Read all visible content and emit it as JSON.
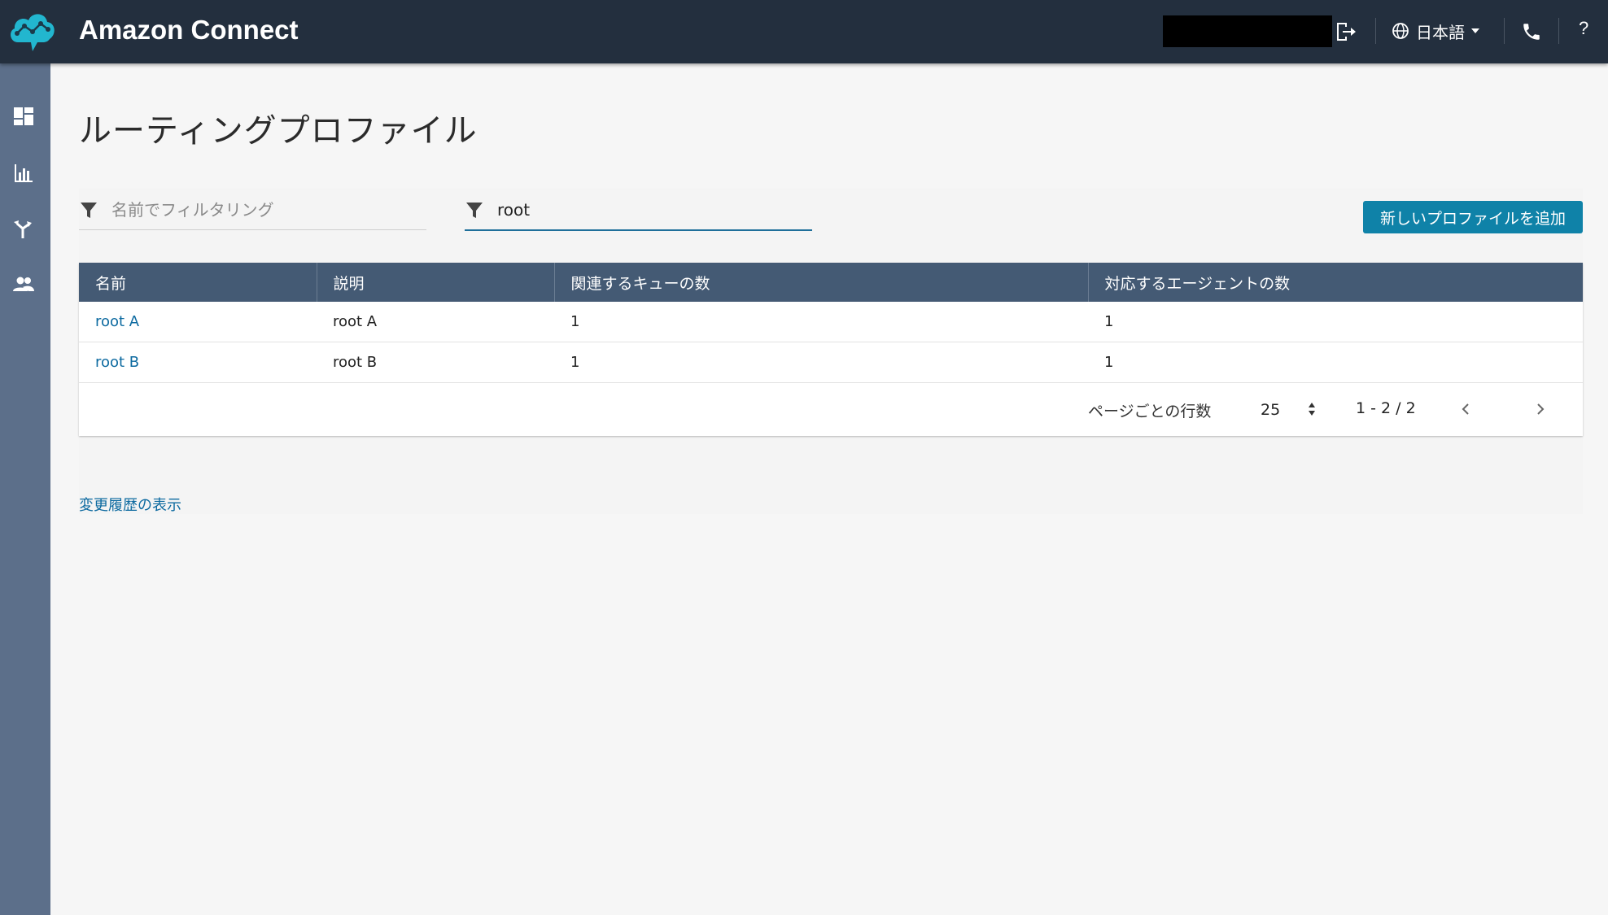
{
  "header": {
    "app_title": "Amazon Connect",
    "language": "日本語",
    "help": "?",
    "icons": [
      "amazon-connect-logo",
      "logout-icon",
      "globe-icon",
      "phone-icon"
    ]
  },
  "sidebar": {
    "items": [
      {
        "icon": "dashboard-icon"
      },
      {
        "icon": "metrics-chart-icon"
      },
      {
        "icon": "routing-icon"
      },
      {
        "icon": "users-icon"
      }
    ]
  },
  "page": {
    "title": "ルーティングプロファイル"
  },
  "filters": {
    "name_placeholder": "名前でフィルタリング",
    "second_value": "root"
  },
  "actions": {
    "add_profile": "新しいプロファイルを追加"
  },
  "table": {
    "columns": [
      "名前",
      "説明",
      "関連するキューの数",
      "対応するエージェントの数"
    ],
    "rows": [
      {
        "name": "root A",
        "description": "root A",
        "queues": "1",
        "agents": "1"
      },
      {
        "name": "root B",
        "description": "root B",
        "queues": "1",
        "agents": "1"
      }
    ]
  },
  "pagination": {
    "rows_per_page_label": "ページごとの行数",
    "rows_per_page": "25",
    "range": "1 - 2 / 2"
  },
  "footer": {
    "history_link": "変更履歴の表示"
  },
  "colors": {
    "topbar": "#232f3e",
    "sidebar": "#5c6f8a",
    "table_header": "#445a74",
    "primary_button": "#0f82a8",
    "link": "#0d6aa0",
    "logo": "#22b6cf"
  }
}
